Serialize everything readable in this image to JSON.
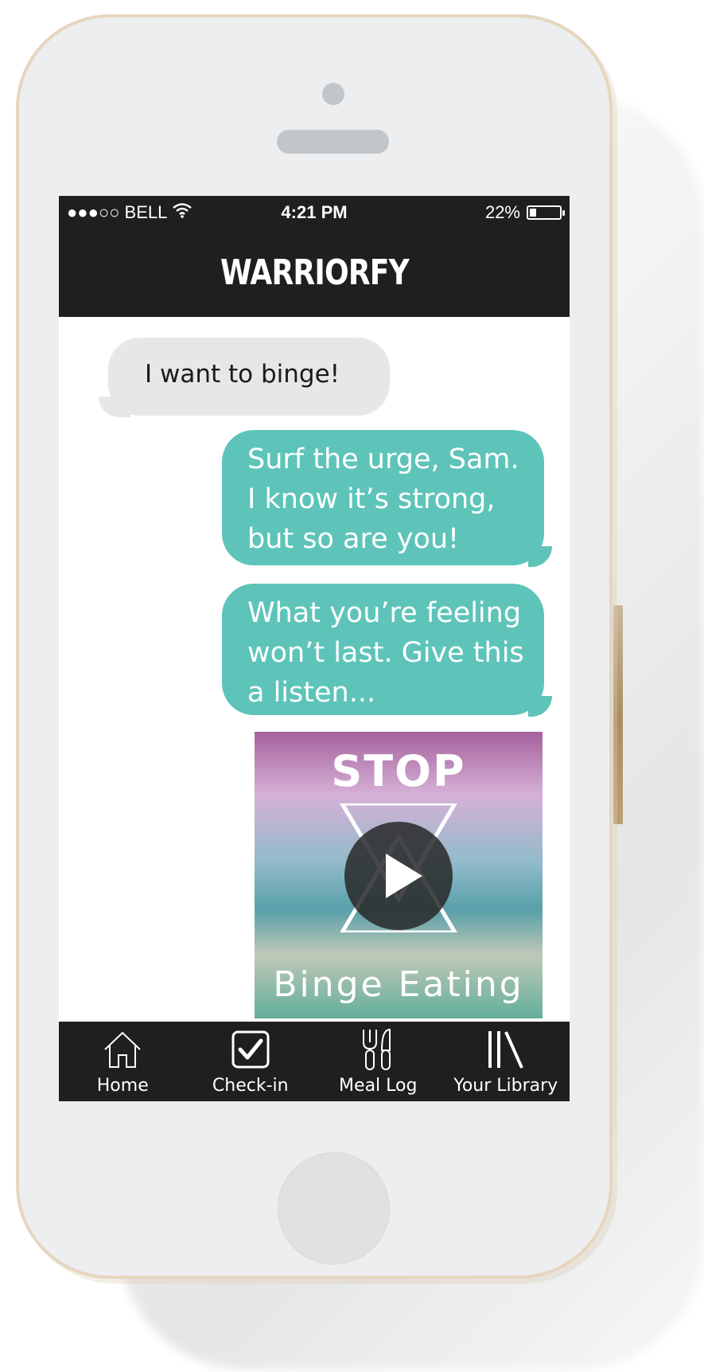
{
  "status_bar": {
    "carrier": "●●●○○ BELL",
    "time": "4:21 PM",
    "battery": "22%",
    "battery_level": 0.22
  },
  "app": {
    "title": "WARRIORFY"
  },
  "messages": [
    {
      "from": "user",
      "text": "I want to binge!"
    },
    {
      "from": "app",
      "lines": [
        "Surf the urge, Sam.",
        "I know it’s strong,",
        "but so are you!"
      ]
    },
    {
      "from": "app",
      "lines": [
        "What you’re feeling",
        "won’t last. Give this",
        "a listen..."
      ]
    }
  ],
  "media_card": {
    "headline": "STOP",
    "caption": "Binge Eating",
    "action_icon": "play-icon"
  },
  "tab_bar": [
    {
      "label": "Home",
      "icon": "home-icon"
    },
    {
      "label": "Check-in",
      "icon": "checkbox-icon"
    },
    {
      "label": "Meal Log",
      "icon": "fork-knife-icon"
    },
    {
      "label": "Your Library",
      "icon": "library-icon"
    }
  ],
  "colors": {
    "bar": "#1f1f1f",
    "outgoing_bubble": "#5ec4b9",
    "incoming_bubble": "#e6e7e8",
    "phone_frame": "#e6d6bf"
  }
}
